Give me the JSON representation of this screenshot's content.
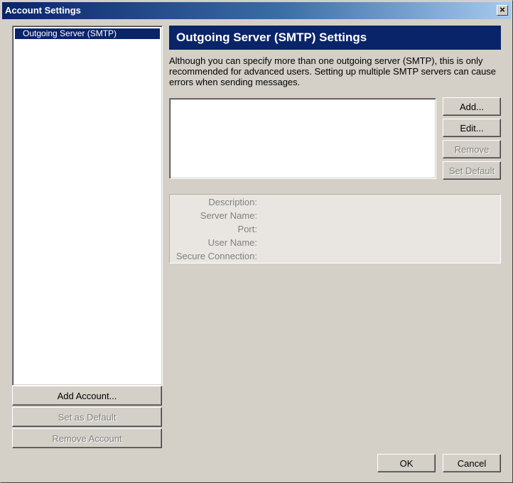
{
  "window": {
    "title": "Account Settings",
    "close_label": "×"
  },
  "sidebar": {
    "accounts": [
      {
        "label": "Outgoing Server (SMTP)",
        "selected": true
      }
    ],
    "add_account_label": "Add Account...",
    "set_default_label": "Set as Default",
    "remove_account_label": "Remove Account"
  },
  "main": {
    "header": "Outgoing Server (SMTP) Settings",
    "description": "Although you can specify more than one outgoing server (SMTP), this is only recommended for advanced users. Setting up multiple SMTP servers can cause errors when sending messages.",
    "buttons": {
      "add": "Add...",
      "edit": "Edit...",
      "remove": "Remove",
      "set_default": "Set Default"
    },
    "details": {
      "description_label": "Description:",
      "server_name_label": "Server Name:",
      "port_label": "Port:",
      "user_name_label": "User Name:",
      "secure_connection_label": "Secure Connection:"
    }
  },
  "footer": {
    "ok_label": "OK",
    "cancel_label": "Cancel"
  },
  "colors": {
    "title_bar": "#0a246a",
    "selection": "#0a246a",
    "face": "#d4d0c8"
  }
}
